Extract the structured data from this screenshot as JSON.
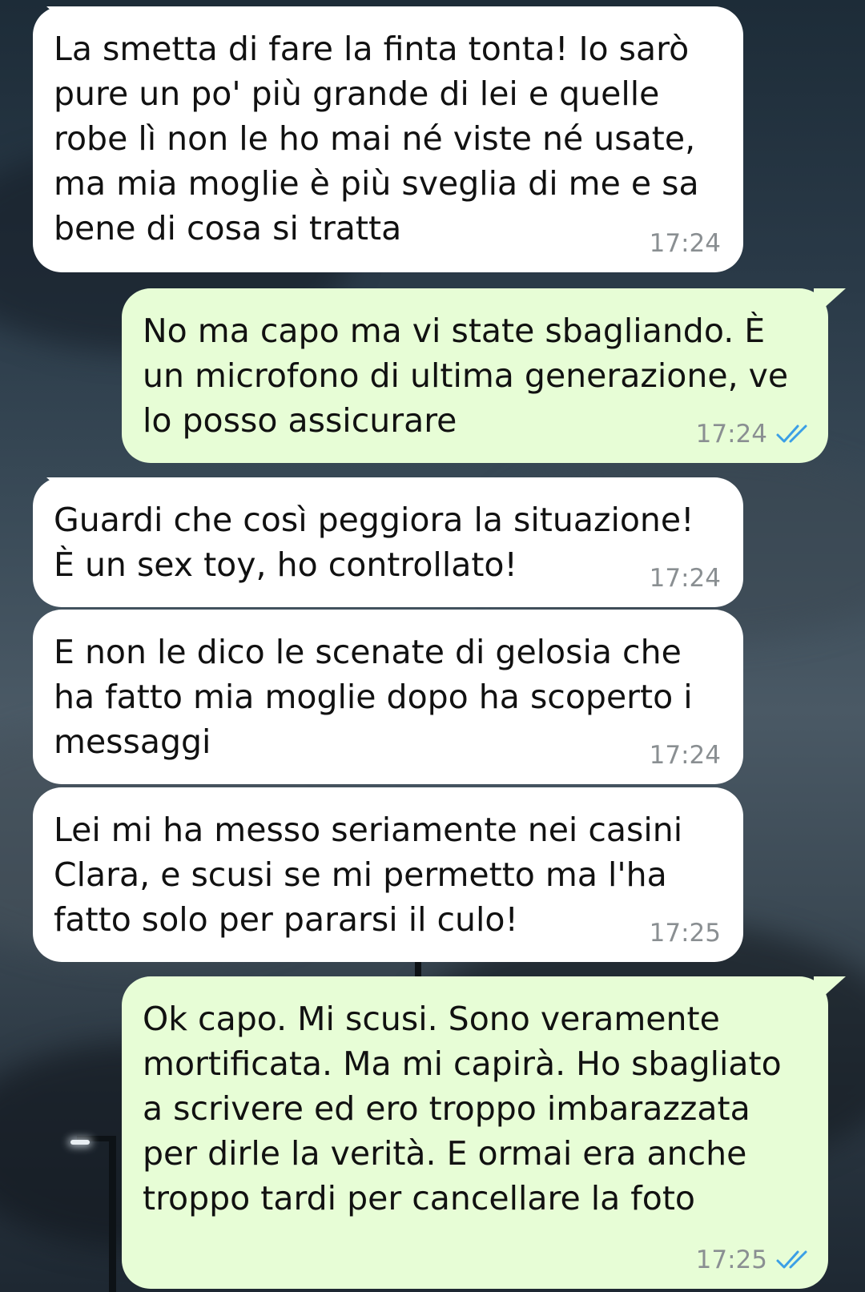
{
  "colors": {
    "incoming_bubble": "#ffffff",
    "outgoing_bubble": "#e7fdd6",
    "timestamp": "#8a8f92",
    "read_receipt": "#3b9fe6"
  },
  "messages": [
    {
      "direction": "incoming",
      "text": "La smetta di fare la finta tonta! Io sarò pure un po' più grande di lei e quelle robe lì non le ho mai né viste né usate, ma mia moglie è più sveglia di me e sa bene di cosa si tratta",
      "time": "17:24"
    },
    {
      "direction": "outgoing",
      "text": "No ma capo ma vi state sbagliando. È un microfono di ultima generazione, ve lo posso assicurare",
      "time": "17:24",
      "status_icon": "double-check-read-icon"
    },
    {
      "direction": "incoming",
      "text": "Guardi che così peggiora la situazione! È un sex toy, ho controllato!",
      "time": "17:24"
    },
    {
      "direction": "incoming",
      "text": "E non le dico le scenate di gelosia che ha fatto mia moglie dopo ha scoperto i messaggi",
      "time": "17:24"
    },
    {
      "direction": "incoming",
      "text": "Lei mi ha messo seriamente nei casini Clara, e scusi se mi permetto ma l'ha fatto solo per pararsi il culo!",
      "time": "17:25"
    },
    {
      "direction": "outgoing",
      "text": "Ok capo. Mi scusi. Sono veramente mortificata. Ma mi capirà. Ho sbagliato a scrivere ed ero troppo imbarazzata per dirle la verità. E ormai era anche troppo tardi per cancellare la foto",
      "time": "17:25",
      "status_icon": "double-check-read-icon"
    }
  ]
}
